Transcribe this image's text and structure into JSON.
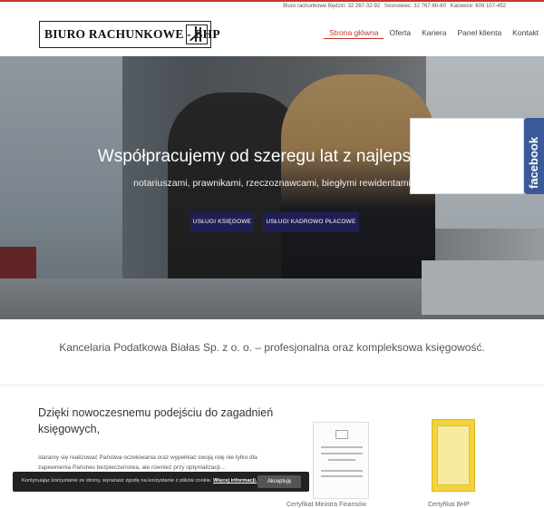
{
  "topbar": {
    "items": [
      "Biuro rachunkowe Będzin: 32 267-32-92",
      "Sosnowiec: 32 767-60-60",
      "Katowice: 609 107-452"
    ]
  },
  "header": {
    "logo_text": "BIURO RACHUNKOWE - BHP",
    "nav": [
      "Strona główna",
      "Oferta",
      "Kariera",
      "Panel klienta",
      "Kontakt"
    ]
  },
  "hero": {
    "title": "Współpracujemy od szeregu lat z najlepszymi",
    "subtitle": "notariuszami, prawnikami, rzeczoznawcami, biegłymi rewidentami",
    "buttons": [
      "USŁUGI KSIĘGOWE",
      "USŁUGI KADROWO PŁACOWE"
    ]
  },
  "facebook_tab": {
    "label": "facebook"
  },
  "tagline": "Kancelaria Podatkowa Białas Sp. z o. o. – profesjonalna oraz kompleksowa księgowość.",
  "section": {
    "title": "Dzięki nowoczesnemu podejściu do zagadnień księgowych,",
    "text": "staramy się realizować Państwa oczekiwania oraz wypełniać swoją rolę nie tylko dla zapewnienia Państwu bezpieczeństwa, ale również przy optymalizacji..."
  },
  "certificates": [
    "Certyfikat Ministra Finansów",
    "Certyfikat BHP"
  ],
  "cookie": {
    "text": "Kontynuując korzystanie ze strony, wyrażasz zgodę na korzystanie z plików cookie.",
    "link": "Więcej informacji.",
    "button": "Akceptuję"
  },
  "colors": {
    "accent": "#c0392b",
    "button_bg": "#1f1f55",
    "facebook": "#3b5998"
  }
}
